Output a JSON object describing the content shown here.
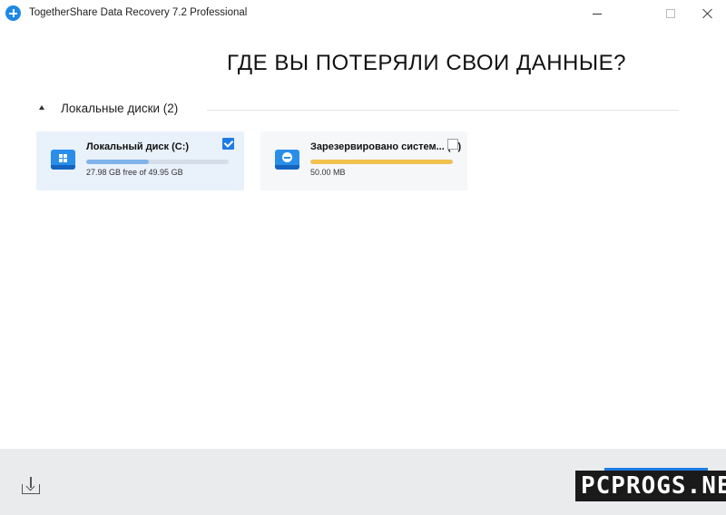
{
  "window": {
    "title": "TogetherShare Data Recovery 7.2 Professional",
    "icon": "app-logo-plus-icon",
    "controls": [
      "minimize-icon",
      "maximize-icon",
      "close-icon"
    ]
  },
  "main": {
    "heading": "ГДЕ ВЫ ПОТЕРЯЛИ СВОИ ДАННЫЕ?",
    "section": {
      "title": "Локальные диски (2)",
      "disks": [
        {
          "name": "Локальный диск (C:)",
          "subtitle": "27.98 GB free of 49.95 GB",
          "used_fraction": 0.44,
          "selected": true,
          "icon": "windows-drive-icon"
        },
        {
          "name": "Зарезервировано систем... (*:)",
          "subtitle": "50.00 MB",
          "used_fraction": 1.0,
          "selected": false,
          "icon": "system-drive-icon"
        }
      ]
    }
  },
  "footer": {
    "download_icon": "download-icon",
    "watermark": "PCPROGS.NET"
  },
  "colors": {
    "accent": "#1e7be6",
    "drive_icon": "#2a8ee8",
    "c_bar_fill": "#7fb3ea",
    "reserved_bar_fill": "#f2c14e",
    "selected_card_bg": "#e9f1fb",
    "footer_bg": "#eaebed"
  }
}
